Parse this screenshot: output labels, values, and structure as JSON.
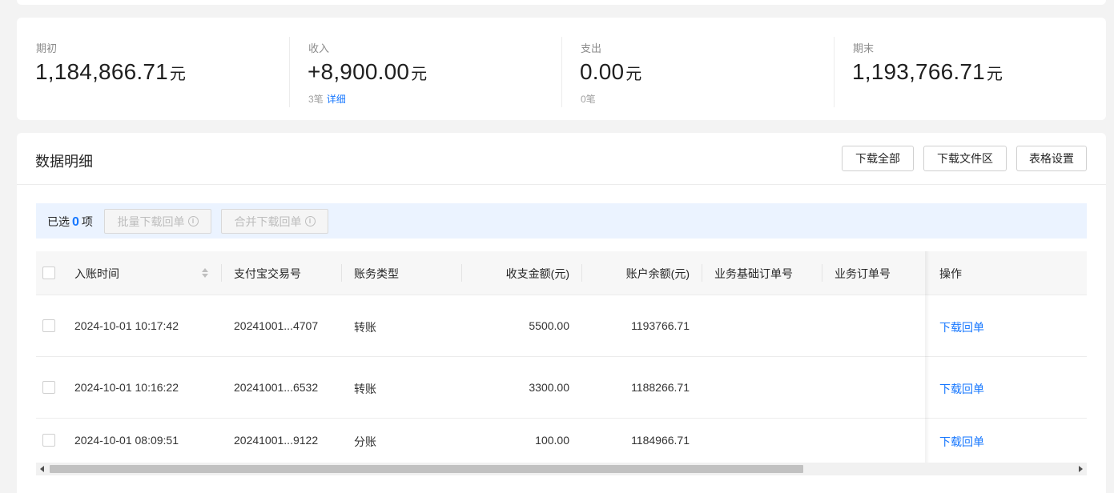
{
  "summary": {
    "opening": {
      "label": "期初",
      "value": "1,184,866.71",
      "unit": "元"
    },
    "income": {
      "label": "收入",
      "value": "+8,900.00",
      "unit": "元",
      "count": "3笔",
      "detail_link": "详细"
    },
    "expense": {
      "label": "支出",
      "value": "0.00",
      "unit": "元",
      "count": "0笔"
    },
    "closing": {
      "label": "期末",
      "value": "1,193,766.71",
      "unit": "元"
    }
  },
  "detail": {
    "title": "数据明细",
    "buttons": {
      "download_all": "下载全部",
      "download_files": "下载文件区",
      "table_settings": "表格设置"
    },
    "selection": {
      "prefix": "已选",
      "count": "0",
      "suffix": "项",
      "batch_download": "批量下载回单",
      "merge_download": "合并下载回单"
    }
  },
  "table": {
    "columns": {
      "time": "入账时间",
      "trade_no": "支付宝交易号",
      "type": "账务类型",
      "amount": "收支金额(元)",
      "balance": "账户余额(元)",
      "base_order": "业务基础订单号",
      "order": "业务订单号",
      "action": "操作"
    },
    "rows": [
      {
        "time": "2024-10-01 10:17:42",
        "trade_no": "20241001...4707",
        "type": "转账",
        "amount": "5500.00",
        "balance": "1193766.71",
        "base_order": "",
        "order": "",
        "action": "下载回单"
      },
      {
        "time": "2024-10-01 10:16:22",
        "trade_no": "20241001...6532",
        "type": "转账",
        "amount": "3300.00",
        "balance": "1188266.71",
        "base_order": "",
        "order": "",
        "action": "下载回单"
      },
      {
        "time": "2024-10-01 08:09:51",
        "trade_no": "20241001...9122",
        "type": "分账",
        "amount": "100.00",
        "balance": "1184966.71",
        "base_order": "",
        "order": "",
        "action": "下载回单"
      }
    ]
  },
  "colors": {
    "accent": "#1677ff",
    "selection_bar": "#ebf3ff"
  }
}
